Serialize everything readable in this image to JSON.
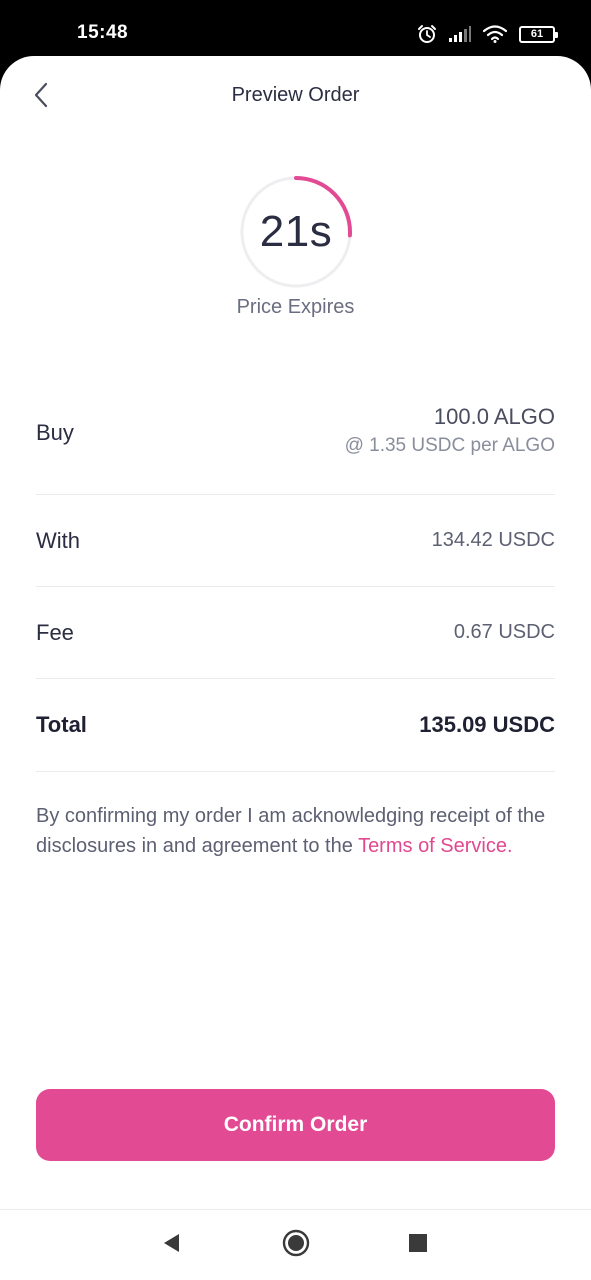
{
  "status_bar": {
    "time": "15:48",
    "battery": "61",
    "icons": [
      "alarm-icon",
      "signal-icon",
      "wifi-icon",
      "battery-icon"
    ]
  },
  "header": {
    "title": "Preview Order",
    "back_icon": "chevron-left-icon"
  },
  "timer": {
    "value": "21s",
    "label": "Price Expires",
    "remaining_fraction": 0.26,
    "accent_color": "#e24a94"
  },
  "order": {
    "buy": {
      "label": "Buy",
      "amount": "100.0 ALGO",
      "rate": "@ 1.35 USDC per ALGO"
    },
    "with": {
      "label": "With",
      "value": "134.42 USDC"
    },
    "fee": {
      "label": "Fee",
      "value": "0.67 USDC"
    },
    "total": {
      "label": "Total",
      "value": "135.09 USDC"
    }
  },
  "disclosure": {
    "text": "By confirming my order I am acknowledging receipt of the disclosures in and agreement to the ",
    "link_text": "Terms of Service",
    "suffix": "."
  },
  "confirm_button": {
    "label": "Confirm Order",
    "color": "#e24a94"
  },
  "nav_bar": {
    "icons": [
      "nav-back-icon",
      "nav-home-icon",
      "nav-recents-icon"
    ]
  }
}
